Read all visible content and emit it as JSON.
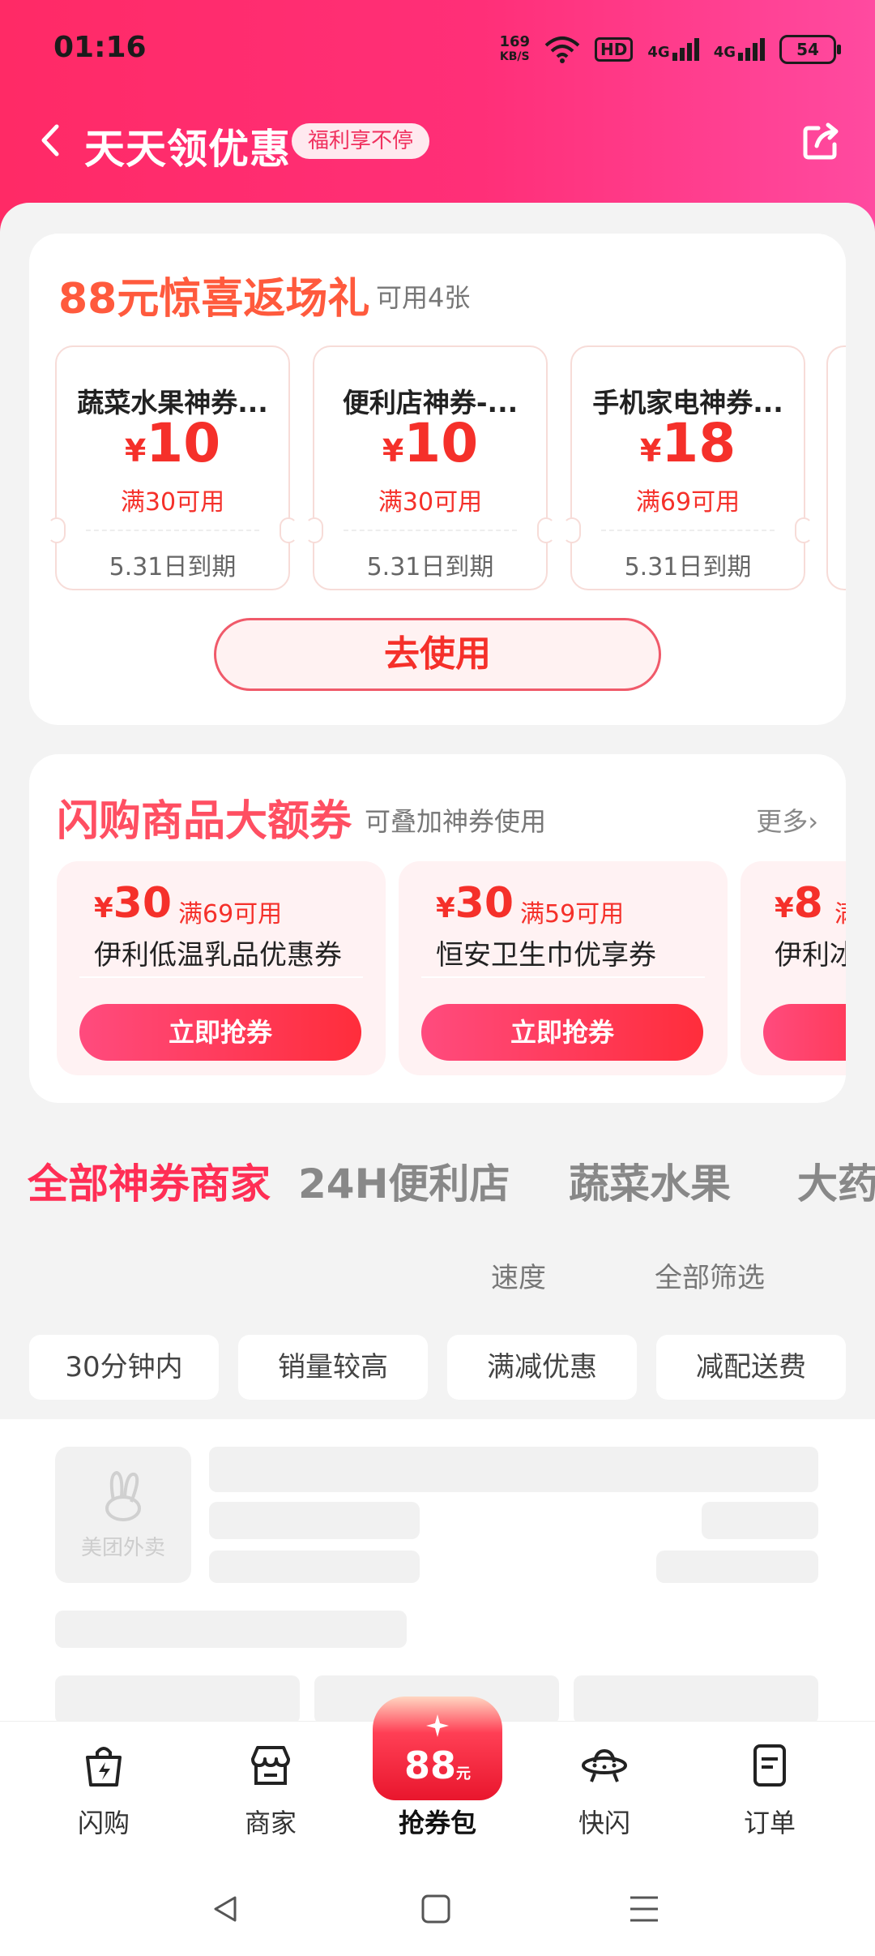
{
  "status_bar": {
    "time": "01:16",
    "speed_value": "169",
    "speed_unit": "KB/S",
    "hd": "HD",
    "signal1": "4G",
    "signal2": "4G",
    "battery": "54"
  },
  "header": {
    "title": "天天领优惠",
    "badge": "福利享不停",
    "back_icon": "chevron-left-icon",
    "share_icon": "share-icon"
  },
  "surprise": {
    "title": "88元惊喜返场礼",
    "available": "可用4张",
    "coupons": [
      {
        "name": "蔬菜水果神券...",
        "symbol": "¥",
        "amount": "10",
        "condition": "满30可用",
        "expiry": "5.31日到期"
      },
      {
        "name": "便利店神券-...",
        "symbol": "¥",
        "amount": "10",
        "condition": "满30可用",
        "expiry": "5.31日到期"
      },
      {
        "name": "手机家电神券...",
        "symbol": "¥",
        "amount": "18",
        "condition": "满69可用",
        "expiry": "5.31日到期"
      }
    ],
    "use_button": "去使用"
  },
  "flash": {
    "title": "闪购商品大额券",
    "subtitle": "可叠加神券使用",
    "more": "更多›",
    "items": [
      {
        "symbol": "¥",
        "amount": "30",
        "condition": "满69可用",
        "name": "伊利低温乳品优惠券",
        "button": "立即抢券"
      },
      {
        "symbol": "¥",
        "amount": "30",
        "condition": "满59可用",
        "name": "恒安卫生巾优享券",
        "button": "立即抢券"
      },
      {
        "symbol": "¥",
        "amount": "8",
        "condition": "满",
        "name": "伊利冰",
        "button": ""
      }
    ]
  },
  "category_tabs": [
    "全部神券商家",
    "24H便利店",
    "蔬菜水果",
    "大药"
  ],
  "sort_options": [
    "速度",
    "全部筛选"
  ],
  "filters": [
    "30分钟内",
    "销量较高",
    "满减优惠",
    "减配送费"
  ],
  "placeholder_logo_text": "美团外卖",
  "bottom_nav": [
    {
      "label": "闪购",
      "icon": "shopping-bag-lightning-icon"
    },
    {
      "label": "商家",
      "icon": "store-icon"
    },
    {
      "label": "抢券包",
      "icon": "red-envelope-icon",
      "badge_amount": "88",
      "badge_unit": "元"
    },
    {
      "label": "快闪",
      "icon": "ufo-icon"
    },
    {
      "label": "订单",
      "icon": "order-list-icon"
    }
  ],
  "colors": {
    "brand": "#ff2a66",
    "accent_red": "#f5302a"
  }
}
